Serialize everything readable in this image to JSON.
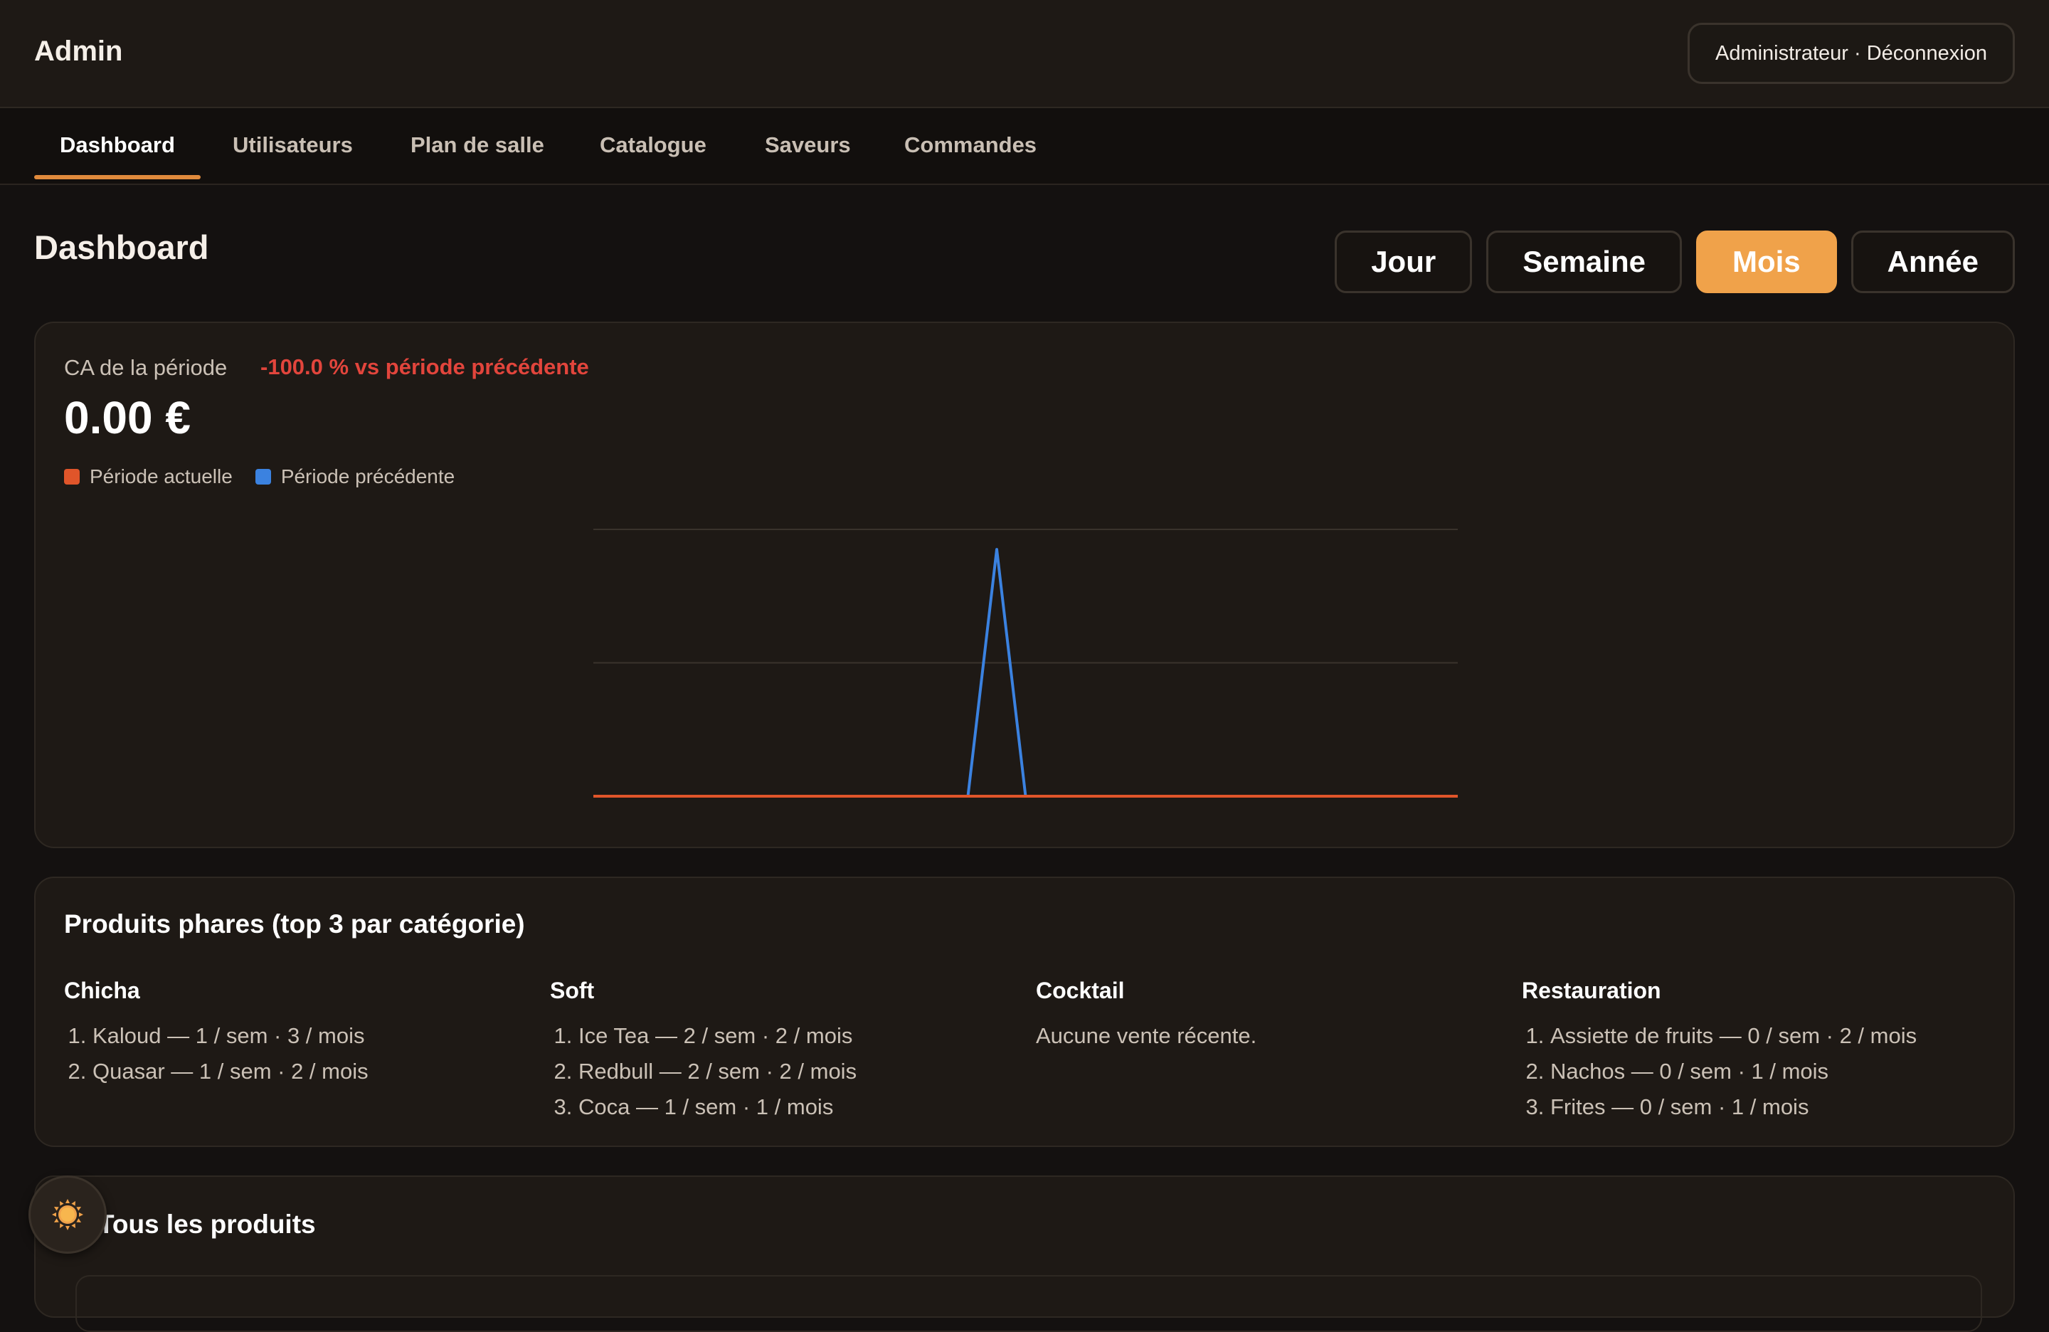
{
  "app": {
    "brand": "Admin",
    "user_menu": "Administrateur · Déconnexion"
  },
  "nav": {
    "tabs": [
      {
        "label": "Dashboard",
        "active": true
      },
      {
        "label": "Utilisateurs"
      },
      {
        "label": "Plan de salle"
      },
      {
        "label": "Catalogue"
      },
      {
        "label": "Saveurs"
      },
      {
        "label": "Commandes"
      }
    ]
  },
  "dashboard": {
    "title": "Dashboard",
    "periods": [
      {
        "label": "Jour"
      },
      {
        "label": "Semaine"
      },
      {
        "label": "Mois",
        "active": true
      },
      {
        "label": "Année"
      }
    ],
    "revenue": {
      "label": "CA de la période",
      "delta": "-100.0 % vs période précédente",
      "value": "0.00 €",
      "legend": {
        "current": "Période actuelle",
        "previous": "Période précédente"
      }
    },
    "top_products": {
      "title": "Produits phares (top 3 par catégorie)",
      "categories": [
        {
          "name": "Chicha",
          "items": [
            "Kaloud — 1 / sem · 3 / mois",
            "Quasar — 1 / sem · 2 / mois"
          ]
        },
        {
          "name": "Soft",
          "items": [
            "Ice Tea — 2 / sem · 2 / mois",
            "Redbull — 2 / sem · 2 / mois",
            "Coca — 1 / sem · 1 / mois"
          ]
        },
        {
          "name": "Cocktail",
          "items": [],
          "empty": "Aucune vente récente."
        },
        {
          "name": "Restauration",
          "items": [
            "Assiette de fruits — 0 / sem · 2 / mois",
            "Nachos — 0 / sem · 1 / mois",
            "Frites — 0 / sem · 1 / mois"
          ]
        }
      ]
    },
    "all_products": {
      "title": "Tous les produits"
    }
  },
  "colors": {
    "accent": "#f0a24a",
    "current_series": "#e0552a",
    "previous_series": "#3b82e0",
    "negative": "#e2453c"
  },
  "icons": {
    "theme_toggle": "sun-icon"
  },
  "chart_data": {
    "type": "line",
    "x": [
      1,
      2,
      3,
      4,
      5,
      6,
      7,
      8,
      9,
      10,
      11,
      12,
      13,
      14,
      15,
      16,
      17,
      18,
      19,
      20,
      21,
      22,
      23,
      24,
      25,
      26,
      27,
      28,
      29,
      30,
      31
    ],
    "ylim": [
      0,
      2
    ],
    "grid": true,
    "legend_placement": "top-left",
    "series": [
      {
        "name": "Période actuelle",
        "color": "#e0552a",
        "values": [
          0,
          0,
          0,
          0,
          0,
          0,
          0,
          0,
          0,
          0,
          0,
          0,
          0,
          0,
          0,
          0,
          0,
          0,
          0,
          0,
          0,
          0,
          0,
          0,
          0,
          0,
          0,
          0,
          0,
          0,
          0
        ]
      },
      {
        "name": "Période précédente",
        "color": "#3b82e0",
        "values": [
          0,
          0,
          0,
          0,
          0,
          0,
          0,
          0,
          0,
          0,
          0,
          0,
          0,
          0,
          1.85,
          0,
          0,
          0,
          0,
          0,
          0,
          0,
          0,
          0,
          0,
          0,
          0,
          0,
          0,
          0,
          0
        ]
      }
    ]
  }
}
